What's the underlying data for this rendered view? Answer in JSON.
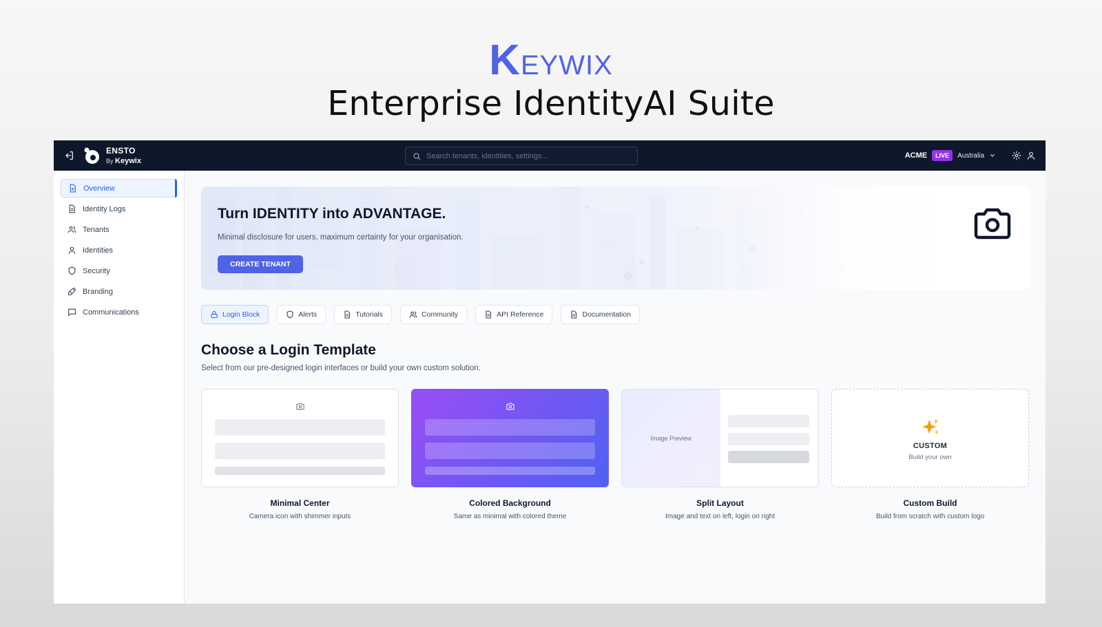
{
  "hero": {
    "brand_initial": "K",
    "brand_rest": "EYWIX",
    "tagline": "Enterprise IdentityAI Suite",
    "brand_color": "#4f63e6"
  },
  "topbar": {
    "product": "ENSTO",
    "by_prefix": "By",
    "by_brand": "Keywix",
    "search_placeholder": "Search tenants, identities, settings...",
    "tenant": "ACME",
    "env_badge": "LIVE",
    "region": "Australia",
    "icons": [
      "exit-icon",
      "logo-icon",
      "search-icon",
      "chevron-down-icon",
      "gear-icon",
      "user-icon"
    ]
  },
  "sidebar": {
    "items": [
      {
        "label": "Overview",
        "icon": "document-icon",
        "active": true
      },
      {
        "label": "Identity Logs",
        "icon": "document-icon"
      },
      {
        "label": "Tenants",
        "icon": "users-icon"
      },
      {
        "label": "Identities",
        "icon": "user-icon"
      },
      {
        "label": "Security",
        "icon": "shield-icon"
      },
      {
        "label": "Branding",
        "icon": "brush-icon"
      },
      {
        "label": "Communications",
        "icon": "message-icon"
      }
    ]
  },
  "banner": {
    "title": "Turn IDENTITY into ADVANTAGE.",
    "subtitle": "Minimal disclosure for users, maximum certainty for your organisation.",
    "cta": "CREATE TENANT"
  },
  "chips": [
    {
      "label": "Login Block",
      "icon": "lock-icon",
      "active": true
    },
    {
      "label": "Alerts",
      "icon": "shield-icon"
    },
    {
      "label": "Tutorials",
      "icon": "document-icon"
    },
    {
      "label": "Community",
      "icon": "users-icon"
    },
    {
      "label": "API Reference",
      "icon": "document-icon"
    },
    {
      "label": "Documentation",
      "icon": "document-icon"
    }
  ],
  "section": {
    "title": "Choose a Login Template",
    "subtitle": "Select from our pre-designed login interfaces or build your own custom solution."
  },
  "templates": [
    {
      "name": "Minimal Center",
      "desc": "Camera icon with shimmer inputs"
    },
    {
      "name": "Colored Background",
      "desc": "Same as minimal with colored theme"
    },
    {
      "name": "Split Layout",
      "desc": "Image and text on left, login on right",
      "preview_label": "Image Preview"
    },
    {
      "name": "Custom Build",
      "desc": "Build from scratch with custom logo",
      "card_title": "CUSTOM",
      "card_sub": "Build your own"
    }
  ]
}
